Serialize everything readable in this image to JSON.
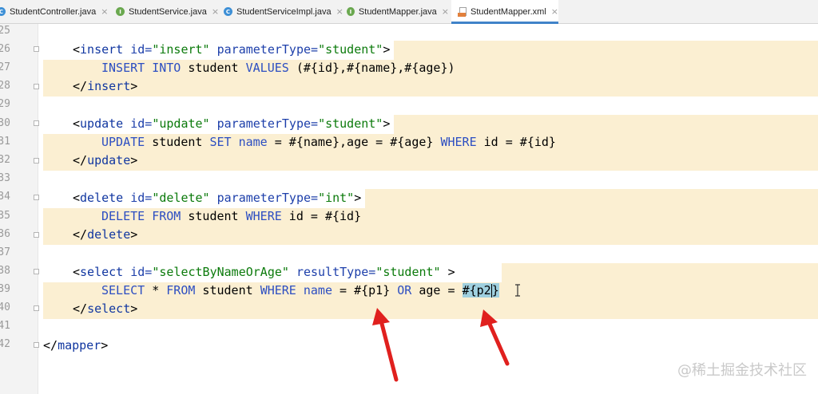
{
  "tabs": [
    {
      "label": "StudentController.java",
      "icon": "class-icon",
      "icon_letter": "C",
      "active": false
    },
    {
      "label": "StudentService.java",
      "icon": "interface-icon",
      "icon_letter": "I",
      "active": false
    },
    {
      "label": "StudentServiceImpl.java",
      "icon": "class-icon",
      "icon_letter": "C",
      "active": false
    },
    {
      "label": "StudentMapper.java",
      "icon": "interface-icon",
      "icon_letter": "I",
      "active": false
    },
    {
      "label": "StudentMapper.xml",
      "icon": "xml-file-icon",
      "icon_letter": "",
      "active": true
    }
  ],
  "tab_close_glyph": "×",
  "gutter": {
    "line_numbers": [
      "25",
      "26",
      "27",
      "28",
      "29",
      "30",
      "31",
      "32",
      "33",
      "34",
      "35",
      "36",
      "37",
      "38",
      "39",
      "40",
      "41",
      "42"
    ]
  },
  "code": {
    "line26": {
      "open": "<",
      "tag": "insert",
      "attr1": " id=",
      "val1": "\"insert\"",
      "attr2": " parameterType=",
      "val2": "\"student\"",
      "close": ">"
    },
    "line27": {
      "kw1": "INSERT INTO",
      "t1": " student ",
      "kw2": "VALUES",
      "t2": " (#{id},#{name},#{age})"
    },
    "line28": {
      "open": "</",
      "tag": "insert",
      "close": ">"
    },
    "line30": {
      "open": "<",
      "tag": "update",
      "attr1": " id=",
      "val1": "\"update\"",
      "attr2": " parameterType=",
      "val2": "\"student\"",
      "close": ">"
    },
    "line31": {
      "kw1": "UPDATE",
      "t1": " student ",
      "kw2": "SET",
      "t2": " ",
      "kw3": "name",
      "t3": " = #{name},age = #{age} ",
      "kw4": "WHERE",
      "t4": " id = #{id}"
    },
    "line32": {
      "open": "</",
      "tag": "update",
      "close": ">"
    },
    "line34": {
      "open": "<",
      "tag": "delete",
      "attr1": " id=",
      "val1": "\"delete\"",
      "attr2": " parameterType=",
      "val2": "\"int\"",
      "close": ">"
    },
    "line35": {
      "kw1": "DELETE FROM",
      "t1": " student ",
      "kw2": "WHERE",
      "t2": " id = #{id}"
    },
    "line36": {
      "open": "</",
      "tag": "delete",
      "close": ">"
    },
    "line38": {
      "open": "<",
      "tag": "select",
      "attr1": " id=",
      "val1": "\"selectByNameOrAge\"",
      "attr2": " resultType=",
      "val2": "\"student\"",
      "close": " >"
    },
    "line39": {
      "kw1": "SELECT",
      "t1": " * ",
      "kw2": "FROM",
      "t2": " student ",
      "kw3": "WHERE",
      "t3": " ",
      "kw4": "name",
      "t4": " = #{p1} ",
      "kw5": "OR",
      "t5": " age = ",
      "sel": "#{p2",
      "after": "}"
    },
    "line40": {
      "open": "</",
      "tag": "select",
      "close": ">"
    },
    "line42": {
      "open": "</",
      "tag": "mapper",
      "close": ">"
    }
  },
  "colors": {
    "highlight": "#fbefd2",
    "selection": "#9fd0df",
    "arrow": "#e0201e",
    "tab_underline": "#4083c9"
  },
  "watermark": "@稀土掘金技术社区"
}
